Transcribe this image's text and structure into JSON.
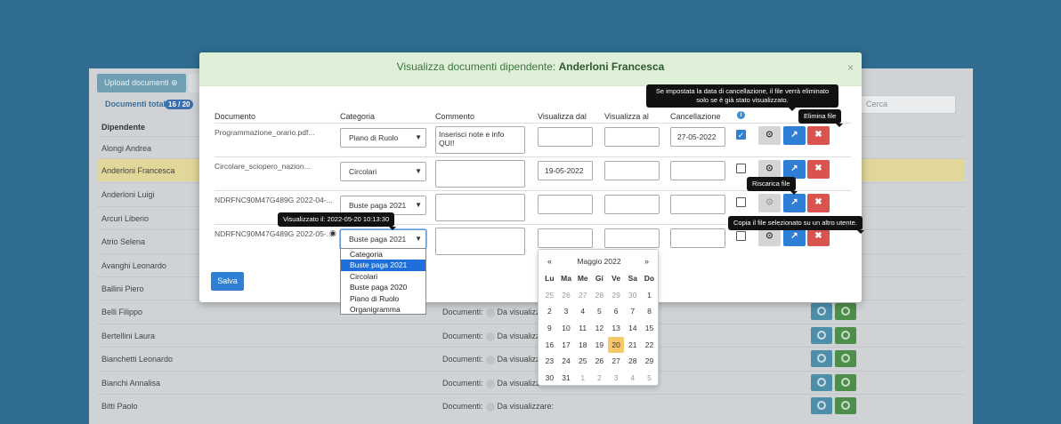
{
  "background": {
    "upload_label": "Upload documenti",
    "totals_label": "Documenti totali",
    "totals_badge": "16 / 20",
    "search_placeholder": "Cerca",
    "column_header": "Dipendente",
    "rows": [
      {
        "name": "Alongi Andrea"
      },
      {
        "name": "Anderloni Francesca"
      },
      {
        "name": "Anderloni Luigi"
      },
      {
        "name": "Arcuri Liberio"
      },
      {
        "name": "Atrio Selena"
      },
      {
        "name": "Avanghi Leonardo"
      },
      {
        "name": "Ballini Piero"
      },
      {
        "name": "Belli Filippo",
        "docs": "Documenti:",
        "vis": "Da visualizz"
      },
      {
        "name": "Bertellini Laura",
        "docs": "Documenti:",
        "vis": "Da visualizz"
      },
      {
        "name": "Bianchetti Leonardo",
        "docs": "Documenti:",
        "vis": "Da visualizz"
      },
      {
        "name": "Bianchi Annalisa",
        "docs": "Documenti:",
        "vis": "Da visualizz"
      },
      {
        "name": "Bitti Paolo",
        "docs": "Documenti:",
        "vis": "Da visualizzare:"
      }
    ]
  },
  "modal": {
    "title_prefix": "Visualizza documenti dipendente:",
    "title_name": "Anderloni Francesca",
    "close": "×",
    "headers": {
      "documento": "Documento",
      "categoria": "Categoria",
      "commento": "Commento",
      "dal": "Visualizza dal",
      "al": "Visualizza al",
      "canc": "Cancellazione"
    },
    "rows": [
      {
        "doc": "Programmazione_orario.pdf...",
        "cat": "Piano di Ruolo",
        "comment": "Inserisci note e info QUI!",
        "dal": "",
        "al": "",
        "canc": "27-05-2022",
        "checked": true
      },
      {
        "doc": "Circolare_sciopero_nazion...",
        "cat": "Circolari",
        "comment": "",
        "dal": "19-05-2022",
        "al": "",
        "canc": "",
        "checked": false
      },
      {
        "doc": "NDRFNC90M47G489G 2022-04-...",
        "cat": "Buste paga 2021",
        "comment": "",
        "dal": "",
        "al": "",
        "canc": "",
        "checked": false
      },
      {
        "doc": "NDRFNC90M47G489G 2022-05-...",
        "cat": "Buste paga 2021",
        "comment": "",
        "dal": "",
        "al": "",
        "canc": "",
        "checked": false
      }
    ],
    "save_label": "Salva"
  },
  "tooltips": {
    "cancellation": "Se impostata la data di cancellazione, il file verrà eliminato solo se è già stato visualizzato.",
    "delete": "Elimina file",
    "download": "Riscarica file",
    "copy": "Copia il file selezionato su un altro utente.",
    "viewed": "Visualizzato il: 2022-05-20 10:13:30"
  },
  "dropdown": {
    "options": [
      "Categoria",
      "Buste paga 2021",
      "Circolari",
      "Buste paga 2020",
      "Piano di Ruolo",
      "Organigramma"
    ],
    "highlighted": "Buste paga 2021"
  },
  "datepicker": {
    "prev": "«",
    "next": "»",
    "title": "Maggio 2022",
    "weekdays": [
      "Lu",
      "Ma",
      "Me",
      "Gi",
      "Ve",
      "Sa",
      "Do"
    ],
    "weeks": [
      [
        "25",
        "26",
        "27",
        "28",
        "29",
        "30",
        "1"
      ],
      [
        "2",
        "3",
        "4",
        "5",
        "6",
        "7",
        "8"
      ],
      [
        "9",
        "10",
        "11",
        "12",
        "13",
        "14",
        "15"
      ],
      [
        "16",
        "17",
        "18",
        "19",
        "20",
        "21",
        "22"
      ],
      [
        "23",
        "24",
        "25",
        "26",
        "27",
        "28",
        "29"
      ],
      [
        "30",
        "31",
        "1",
        "2",
        "3",
        "4",
        "5"
      ]
    ],
    "today": "20"
  },
  "colors": {
    "accent": "#2f7fd7",
    "danger": "#d9534f",
    "header_bg": "#dff0d8",
    "selected_row": "#e2d79a",
    "today": "#f6c86a"
  }
}
